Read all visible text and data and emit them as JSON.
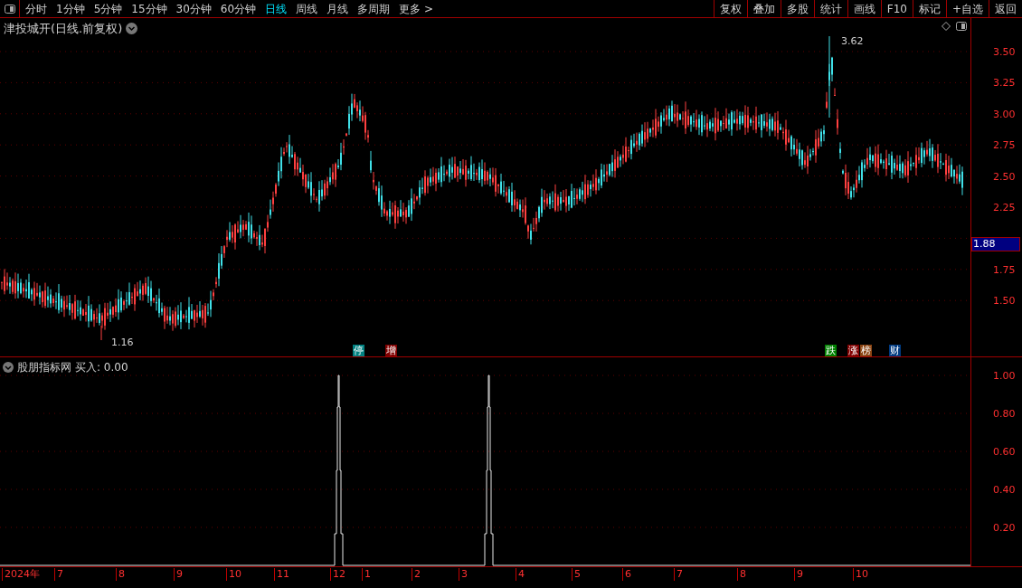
{
  "toolbar": {
    "periods": [
      {
        "label": "分时",
        "selected": false
      },
      {
        "label": "1分钟",
        "selected": false
      },
      {
        "label": "5分钟",
        "selected": false
      },
      {
        "label": "15分钟",
        "selected": false
      },
      {
        "label": "30分钟",
        "selected": false
      },
      {
        "label": "60分钟",
        "selected": false
      },
      {
        "label": "日线",
        "selected": true
      },
      {
        "label": "周线",
        "selected": false
      },
      {
        "label": "月线",
        "selected": false
      },
      {
        "label": "多周期",
        "selected": false
      },
      {
        "label": "更多 >",
        "selected": false
      }
    ],
    "actions": [
      "复权",
      "叠加",
      "多股",
      "统计",
      "画线",
      "F10",
      "标记",
      "+自选",
      "返回"
    ]
  },
  "main_chart": {
    "title": "津投城开(日线.前复权)",
    "high_label": "3.62",
    "low_label": "1.16",
    "current_price": "1.88",
    "price_axis": [
      "3.50",
      "3.25",
      "3.00",
      "2.75",
      "2.50",
      "2.25",
      "1.75",
      "1.50"
    ],
    "badges": [
      {
        "label": "停",
        "color": "#008080"
      },
      {
        "label": "增",
        "color": "#800000"
      },
      {
        "label": "跌",
        "color": "#008000"
      },
      {
        "label": "涨",
        "color": "#800000"
      },
      {
        "label": "榜",
        "color": "#8b4513"
      },
      {
        "label": "财",
        "color": "#003a80"
      }
    ]
  },
  "indicator": {
    "name": "股朋指标网",
    "reading": "买入: 0.00",
    "axis": [
      "1.00",
      "0.80",
      "0.60",
      "0.40",
      "0.20"
    ]
  },
  "time_axis": [
    "2024年",
    "7",
    "8",
    "9",
    "10",
    "11",
    "12",
    "1",
    "2",
    "3",
    "4",
    "5",
    "6",
    "7",
    "8",
    "9",
    "10"
  ]
}
